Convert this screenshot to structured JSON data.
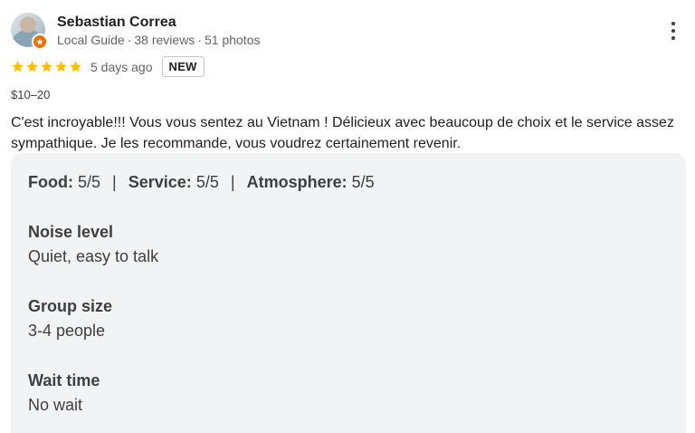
{
  "reviewer": {
    "name": "Sebastian Correa",
    "role": "Local Guide",
    "reviews": "38 reviews",
    "photos": "51 photos",
    "separator": "·"
  },
  "rating": {
    "stars": 5,
    "date": "5 days ago",
    "badge": "NEW",
    "star_color": "#fbbc04"
  },
  "price": "$10–20",
  "text": "C'est incroyable!!! Vous vous sentez au Vietnam ! Délicieux avec beaucoup de choix et le service assez sympathique. Je les recommande, vous voudrez certainement revenir.",
  "scores": {
    "food_label": "Food:",
    "food_value": "5/5",
    "service_label": "Service:",
    "service_value": "5/5",
    "atmosphere_label": "Atmosphere:",
    "atmosphere_value": "5/5",
    "divider": "|"
  },
  "attributes": [
    {
      "label": "Noise level",
      "value": "Quiet, easy to talk"
    },
    {
      "label": "Group size",
      "value": "3-4 people"
    },
    {
      "label": "Wait time",
      "value": "No wait"
    }
  ],
  "icons": {
    "more": "more-vert-icon",
    "badge": "local-guide-badge-icon",
    "star": "star-icon"
  },
  "colors": {
    "details_bg": "#f1f3f4",
    "badge_orange": "#e8710a"
  }
}
